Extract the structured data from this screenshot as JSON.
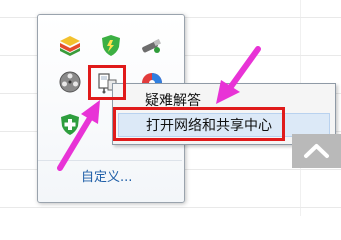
{
  "tray": {
    "customize_label": "自定义...",
    "icons": [
      "bluestacks-icon",
      "security-shield-icon",
      "usb-drive-icon",
      "film-reel-icon",
      "network-icon",
      "color-wheel-icon",
      "shield-cross-icon"
    ]
  },
  "context_menu": {
    "items": [
      {
        "label": "疑难解答",
        "highlighted": false
      },
      {
        "label": "打开网络和共享中心",
        "highlighted": true
      }
    ]
  },
  "expand_button": {
    "icon": "chevron-up-icon"
  },
  "annotations": {
    "highlight_color": "#e01a1a",
    "arrow_color": "#e833d6"
  }
}
